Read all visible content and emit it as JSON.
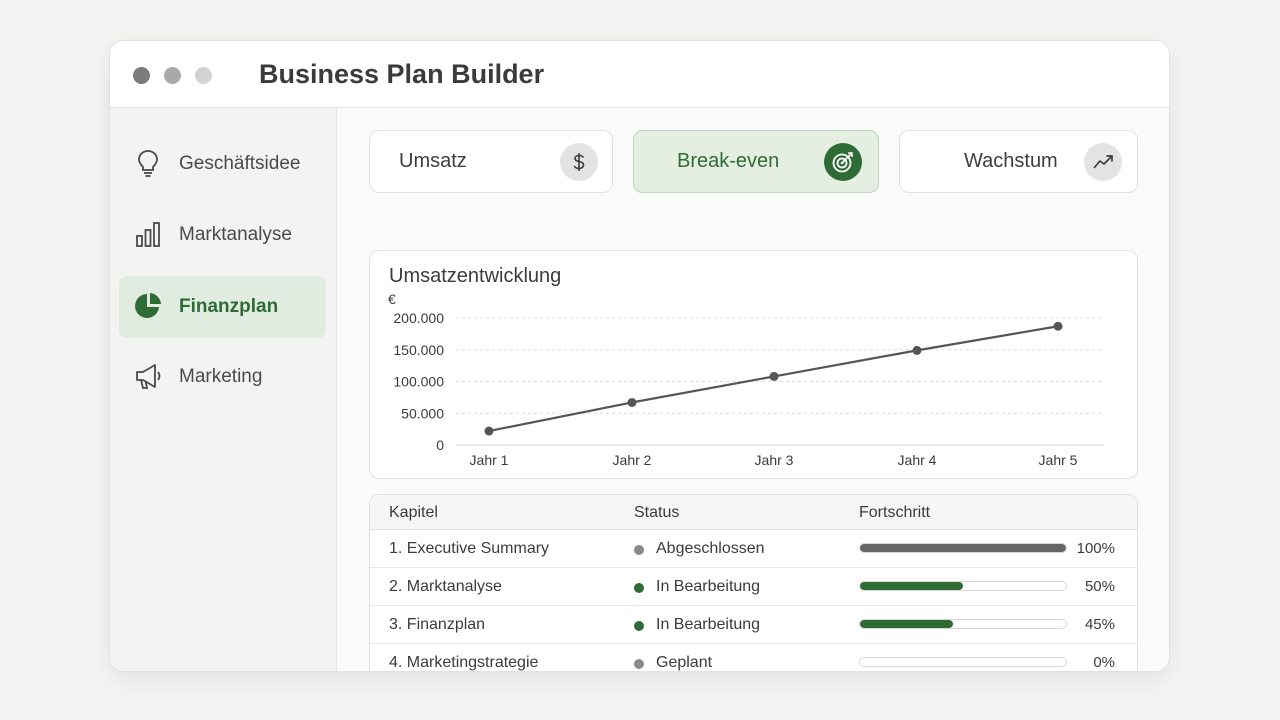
{
  "app": {
    "title": "Business Plan Builder"
  },
  "sidebar": {
    "items": [
      {
        "label": "Geschäftsidee",
        "icon": "lightbulb-icon",
        "active": false
      },
      {
        "label": "Marktanalyse",
        "icon": "bar-chart-icon",
        "active": false
      },
      {
        "label": "Finanzplan",
        "icon": "pie-chart-icon",
        "active": true
      },
      {
        "label": "Marketing",
        "icon": "megaphone-icon",
        "active": false
      }
    ]
  },
  "tabs": [
    {
      "label": "Umsatz",
      "icon": "dollar-icon",
      "active": false
    },
    {
      "label": "Break-even",
      "icon": "target-icon",
      "active": true
    },
    {
      "label": "Wachstum",
      "icon": "trending-up-icon",
      "active": false
    }
  ],
  "chart": {
    "title": "Umsatzentwicklung",
    "unit": "€"
  },
  "chart_data": {
    "type": "line",
    "title": "Umsatzentwicklung",
    "ylabel": "€",
    "categories": [
      "Jahr 1",
      "Jahr 2",
      "Jahr 3",
      "Jahr 4",
      "Jahr 5"
    ],
    "values": [
      22000,
      67000,
      108000,
      149000,
      187000
    ],
    "yticks": [
      "0",
      "50.000",
      "100.000",
      "150.000",
      "200.000"
    ],
    "ylim": [
      0,
      200000
    ],
    "grid": true
  },
  "table": {
    "headers": {
      "chapter": "Kapitel",
      "status": "Status",
      "progress": "Fortschritt"
    },
    "rows": [
      {
        "chapter": "1.  Executive Summary",
        "status": "Abgeschlossen",
        "progress": 100,
        "progress_label": "100%",
        "status_color": "#8a8a8a",
        "bar_color": "#666666"
      },
      {
        "chapter": "2.  Marktanalyse",
        "status": "In Bearbeitung",
        "progress": 50,
        "progress_label": "50%",
        "status_color": "#2e6b35",
        "bar_color": "#2e6b35"
      },
      {
        "chapter": "3.  Finanzplan",
        "status": "In Bearbeitung",
        "progress": 45,
        "progress_label": "45%",
        "status_color": "#2e6b35",
        "bar_color": "#2e6b35"
      },
      {
        "chapter": "4.  Marketingstrategie",
        "status": "Geplant",
        "progress": 0,
        "progress_label": "0%",
        "status_color": "#8a8a8a",
        "bar_color": "#666666"
      }
    ]
  },
  "colors": {
    "accent": "#2e6b35",
    "accent_light": "#e0ece0",
    "line": "#555555"
  }
}
